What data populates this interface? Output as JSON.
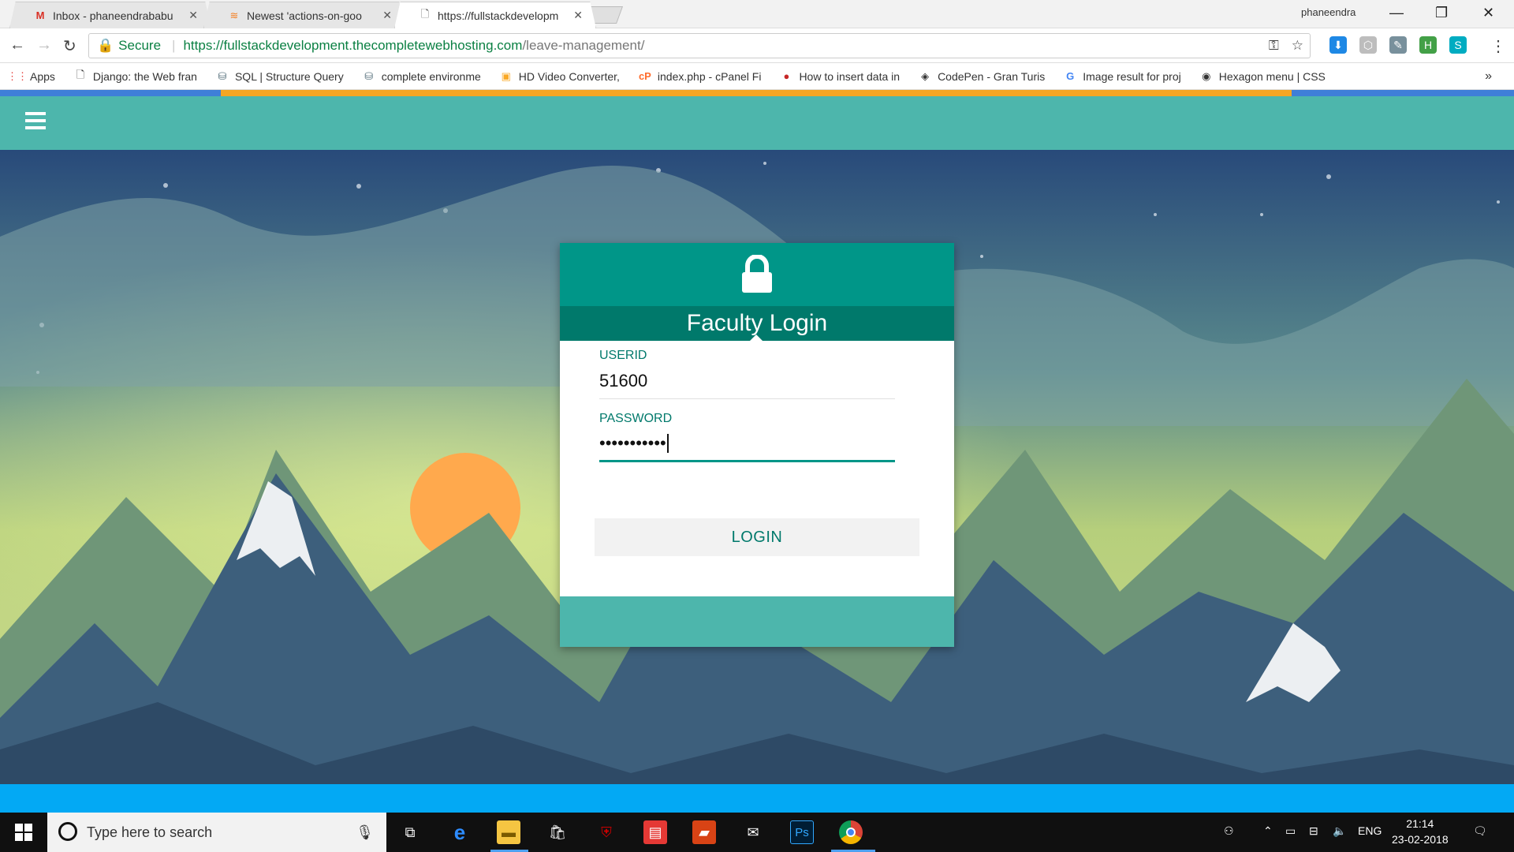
{
  "browser": {
    "tabs": [
      {
        "label": "Inbox - phaneendrababu",
        "icon": "gmail-icon"
      },
      {
        "label": "Newest 'actions-on-goo",
        "icon": "stackoverflow-icon"
      },
      {
        "label": "https://fullstackdevelopm",
        "icon": "page-icon"
      }
    ],
    "profile": "phaneendra",
    "address": {
      "secure_label": "Secure",
      "url_main": "https://fullstackdevelopment.thecompletewebhosting.com",
      "url_path": "/leave-management/"
    },
    "bookmarks": [
      {
        "label": "Apps",
        "icon": "apps-grid-icon"
      },
      {
        "label": "Django: the Web fran",
        "icon": "page-icon"
      },
      {
        "label": "SQL | Structure Query",
        "icon": "sql-icon"
      },
      {
        "label": "complete environme",
        "icon": "sql-icon"
      },
      {
        "label": "HD Video Converter,",
        "icon": "video-icon"
      },
      {
        "label": "index.php - cPanel Fi",
        "icon": "cpanel-icon"
      },
      {
        "label": "How to insert data in",
        "icon": "page-icon"
      },
      {
        "label": "CodePen - Gran Turis",
        "icon": "codepen-icon"
      },
      {
        "label": "Image result for proj",
        "icon": "google-icon"
      },
      {
        "label": "Hexagon menu | CSS",
        "icon": "page-icon"
      }
    ],
    "bookmarks_more": "»"
  },
  "login": {
    "title": "Faculty Login",
    "userid_label": "USERID",
    "userid_value": "51600",
    "password_label": "PASSWORD",
    "password_value": "•••••••••••",
    "button": "LOGIN"
  },
  "taskbar": {
    "search_placeholder": "Type here to search",
    "tray_lang": "ENG",
    "time": "21:14",
    "date": "23-02-2018"
  },
  "colors": {
    "appbar": "#4db6ac",
    "card_header": "#009688",
    "card_title": "#00796b",
    "accent_text": "#00796b"
  }
}
